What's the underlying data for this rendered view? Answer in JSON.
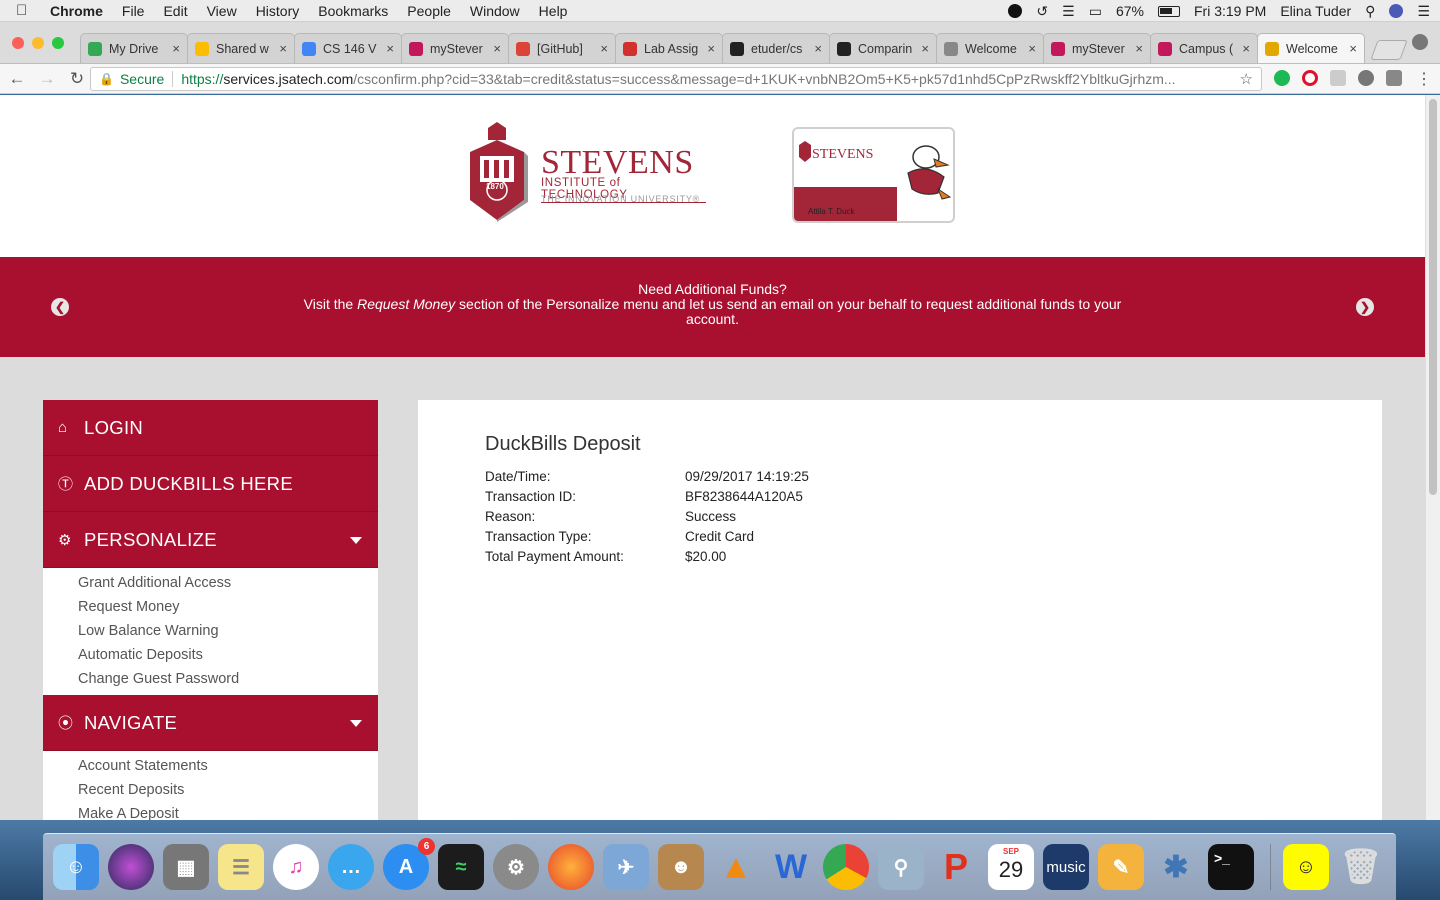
{
  "menubar": {
    "app": "Chrome",
    "items": [
      "File",
      "Edit",
      "View",
      "History",
      "Bookmarks",
      "People",
      "Window",
      "Help"
    ],
    "battery": "67%",
    "clock": "Fri 3:19 PM",
    "user": "Elina Tuder"
  },
  "tabs": [
    {
      "title": "My Drive",
      "favicon_color": "#34a853",
      "active": false
    },
    {
      "title": "Shared w",
      "favicon_color": "#fbbc04",
      "active": false
    },
    {
      "title": "CS 146 V",
      "favicon_color": "#4285f4",
      "active": false
    },
    {
      "title": "myStever",
      "favicon_color": "#c2185b",
      "active": false
    },
    {
      "title": "[GitHub]",
      "favicon_color": "#db4437",
      "active": false
    },
    {
      "title": "Lab Assig",
      "favicon_color": "#d32f2f",
      "active": false
    },
    {
      "title": "etuder/cs",
      "favicon_color": "#222222",
      "active": false
    },
    {
      "title": "Comparin",
      "favicon_color": "#222222",
      "active": false
    },
    {
      "title": "Welcome",
      "favicon_color": "#888888",
      "active": false
    },
    {
      "title": "myStever",
      "favicon_color": "#c2185b",
      "active": false
    },
    {
      "title": "Campus (",
      "favicon_color": "#c2185b",
      "active": false
    },
    {
      "title": "Welcome",
      "favicon_color": "#e0a800",
      "active": true
    }
  ],
  "toolbar": {
    "secure_label": "Secure",
    "url_proto": "https://",
    "url_host": "services.jsatech.com",
    "url_rest": "/csconfirm.php?cid=33&tab=credit&status=success&message=d+1KUK+vnbNB2Om5+K5+pk57d1nhd5CpPzRwskff2YbltkuGjrhzm..."
  },
  "header": {
    "logo_name": "STEVENS",
    "logo_institute": "INSTITUTE of TECHNOLOGY",
    "logo_tagline": "THE INNOVATION UNIVERSITY®",
    "logo_year": "1870",
    "card_name": "STEVENS",
    "card_holder": "Attila T. Duck"
  },
  "banner": {
    "line1": "Need Additional Funds?",
    "line2_pre": "Visit the ",
    "line2_em": "Request Money",
    "line2_post": " section of the Personalize menu and let us send an email on your behalf to request additional funds to your account."
  },
  "sidebar": {
    "login": "LOGIN",
    "add_duckbills": "ADD DUCKBILLS HERE",
    "personalize": "PERSONALIZE",
    "personalize_items": [
      "Grant Additional Access",
      "Request Money",
      "Low Balance Warning",
      "Automatic Deposits",
      "Change Guest Password"
    ],
    "navigate": "NAVIGATE",
    "navigate_items": [
      "Account Statements",
      "Recent Deposits",
      "Make A Deposit"
    ]
  },
  "receipt": {
    "title": "DuckBills Deposit",
    "rows": [
      {
        "label": "Date/Time:",
        "value": "09/29/2017 14:19:25"
      },
      {
        "label": "Transaction ID:",
        "value": "BF8238644A120A5"
      },
      {
        "label": "Reason:",
        "value": "Success"
      },
      {
        "label": "Transaction Type:",
        "value": "Credit Card"
      },
      {
        "label": "Total Payment Amount:",
        "value": "$20.00"
      }
    ]
  },
  "dock": {
    "appstore_badge": "6",
    "calendar_month": "SEP",
    "calendar_day": "29",
    "music_label": "music"
  },
  "colors": {
    "brand_red": "#a9102f",
    "page_bg": "#dcdcdc"
  }
}
